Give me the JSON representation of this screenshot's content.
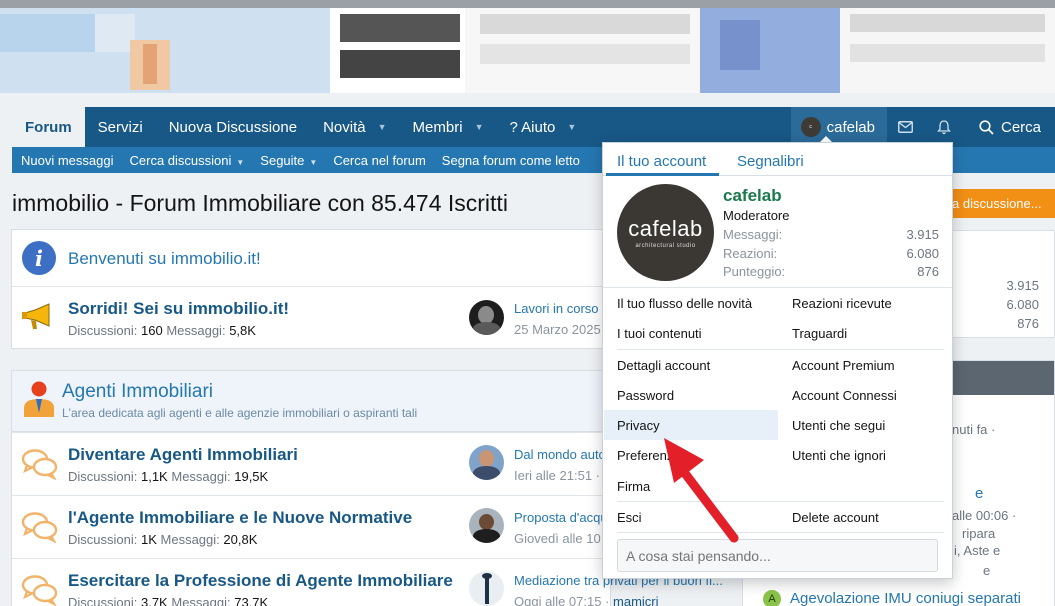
{
  "nav": {
    "tabs": [
      {
        "label": "Forum"
      },
      {
        "label": "Servizi"
      },
      {
        "label": "Nuova Discussione"
      },
      {
        "label": "Novità"
      },
      {
        "label": "Membri"
      },
      {
        "label": "? Aiuto"
      }
    ],
    "user_label": "cafelab",
    "search_label": "Cerca"
  },
  "subnav": {
    "items": [
      {
        "label": "Nuovi messaggi"
      },
      {
        "label": "Cerca discussioni"
      },
      {
        "label": "Seguite"
      },
      {
        "label": "Cerca nel forum"
      },
      {
        "label": "Segna forum come letto"
      }
    ]
  },
  "page": {
    "title": "immobilio - Forum Immobiliare con 85.474 Iscritti",
    "new_discussion_label": "a discussione..."
  },
  "welcome": {
    "title": "Benvenuti su immobilio.it!"
  },
  "forums_top": [
    {
      "title": "Sorridi! Sei su immobilio.it!",
      "stats_prefix": "Discussioni:",
      "threads": "160",
      "stats_mid": "Messaggi:",
      "posts": "5,8K",
      "last_title": "Lavori in corso",
      "last_meta": "25 Marzo 2025"
    }
  ],
  "category": {
    "title": "Agenti Immobiliari",
    "description": "L'area dedicata agli agenti e alle agenzie immobiliari o aspiranti tali"
  },
  "forums": [
    {
      "title": "Diventare Agenti Immobiliari",
      "stats_prefix": "Discussioni:",
      "threads": "1,1K",
      "stats_mid": "Messaggi:",
      "posts": "19,5K",
      "last_title": "Dal mondo auto",
      "last_meta": "Ieri alle 21:51 ·",
      "last_user": ""
    },
    {
      "title": "l'Agente Immobiliare e le Nuove Normative",
      "stats_prefix": "Discussioni:",
      "threads": "1K",
      "stats_mid": "Messaggi:",
      "posts": "20,8K",
      "last_title": "Proposta d'acqu",
      "last_meta": "Giovedì alle 10:",
      "last_user": ""
    },
    {
      "title": "Esercitare la Professione di Agente Immobiliare",
      "stats_prefix": "Discussioni:",
      "threads": "3,7K",
      "stats_mid": "Messaggi:",
      "posts": "73,7K",
      "last_title": "Mediazione tra privati per il buon fi...",
      "last_meta": "Oggi alle 07:15 ·",
      "last_user": "mamicri"
    }
  ],
  "side": {
    "stats": [
      "3.915",
      "6.080",
      "876"
    ],
    "snippets": [
      "nuti fa ·",
      "e",
      "alle 00:06 ·",
      "ripara",
      "i, Aste e",
      "e"
    ],
    "bottom_link": "Agevolazione IMU coniugi separati",
    "bottom_badge": "A"
  },
  "account_menu": {
    "tabs": [
      {
        "label": "Il tuo account"
      },
      {
        "label": "Segnalibri"
      }
    ],
    "avatar_text": "cafelab",
    "avatar_subtext": "architectural studio",
    "username": "cafelab",
    "role": "Moderatore",
    "stats": [
      {
        "label": "Messaggi:",
        "value": "3.915"
      },
      {
        "label": "Reazioni:",
        "value": "6.080"
      },
      {
        "label": "Punteggio:",
        "value": "876"
      }
    ],
    "links_left": [
      "Il tuo flusso delle novità",
      "I tuoi contenuti",
      "Dettagli account",
      "Password",
      "Privacy",
      "Preferenze",
      "Firma",
      "Esci"
    ],
    "links_right": [
      "Reazioni ricevute",
      "Traguardi",
      "Account Premium",
      "Account Connessi",
      "Utenti che segui",
      "Utenti che ignori",
      "Delete account"
    ],
    "status_placeholder": "A cosa stai pensando..."
  }
}
